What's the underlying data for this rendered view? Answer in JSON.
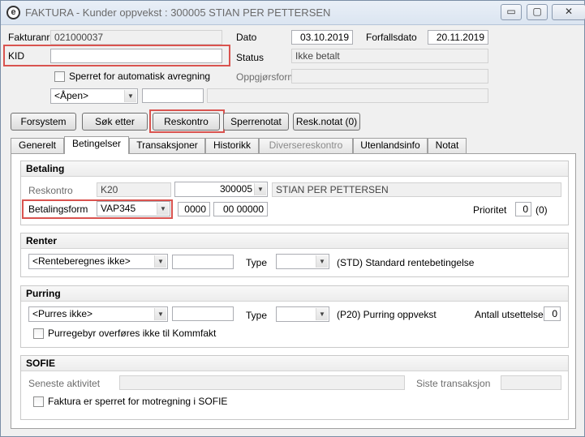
{
  "window": {
    "title": "FAKTURA - Kunder oppvekst : 300005 STIAN PER PETTERSEN",
    "app_icon_glyph": "e",
    "minimize_glyph": "▭",
    "maximize_glyph": "▢",
    "close_glyph": "✕"
  },
  "header": {
    "fakturanr_label": "Fakturanr",
    "fakturanr_value": "021000037",
    "kid_label": "KID",
    "kid_value": "",
    "sperret_label": "Sperret for automatisk avregning",
    "apen_value": "<Åpen>",
    "dato_label": "Dato",
    "dato_value": "03.10.2019",
    "forfallsdato_label": "Forfallsdato",
    "forfallsdato_value": "20.11.2019",
    "status_label": "Status",
    "status_value": "Ikke betalt",
    "oppgjorsform_label": "Oppgjørsform",
    "oppgjorsform_value": ""
  },
  "buttons": {
    "forsystem": "Forsystem",
    "sok_etter": "Søk etter",
    "reskontro": "Reskontro",
    "sperrenotat": "Sperrenotat",
    "resknotat": "Resk.notat (0)"
  },
  "tabs": [
    {
      "label": "Generelt"
    },
    {
      "label": "Betingelser"
    },
    {
      "label": "Transaksjoner"
    },
    {
      "label": "Historikk"
    },
    {
      "label": "Diversereskontro"
    },
    {
      "label": "Utenlandsinfo"
    },
    {
      "label": "Notat"
    }
  ],
  "betaling": {
    "header": "Betaling",
    "reskontro_label": "Reskontro",
    "reskontro_code": "K20",
    "reskontro_number": "300005",
    "reskontro_name": "STIAN PER PETTERSEN",
    "betalingsform_label": "Betalingsform",
    "betalingsform_value": "VAP345",
    "field_a": "0000",
    "field_b": "00 00000",
    "prioritet_label": "Prioritet",
    "prioritet_value": "0",
    "prioritet_extra": "(0)"
  },
  "renter": {
    "header": "Renter",
    "combo_value": "<Renteberegnes ikke>",
    "text_value": "",
    "type_label": "Type",
    "type_value": "",
    "type_desc": "(STD) Standard rentebetingelse"
  },
  "purring": {
    "header": "Purring",
    "combo_value": "<Purres ikke>",
    "text_value": "",
    "type_label": "Type",
    "type_value": "",
    "type_desc": "(P20) Purring oppvekst",
    "antall_label": "Antall utsettelser",
    "antall_value": "0",
    "purregebyr_label": "Purregebyr overføres ikke til Kommfakt"
  },
  "sofie": {
    "header": "SOFIE",
    "seneste_label": "Seneste aktivitet",
    "seneste_value": "",
    "siste_label": "Siste transaksjon",
    "siste_value": "",
    "sperret_label": "Faktura er sperret for motregning i SOFIE"
  },
  "colors": {
    "highlight_box": "#d9534f",
    "window_bg": "#f0f0f0"
  }
}
